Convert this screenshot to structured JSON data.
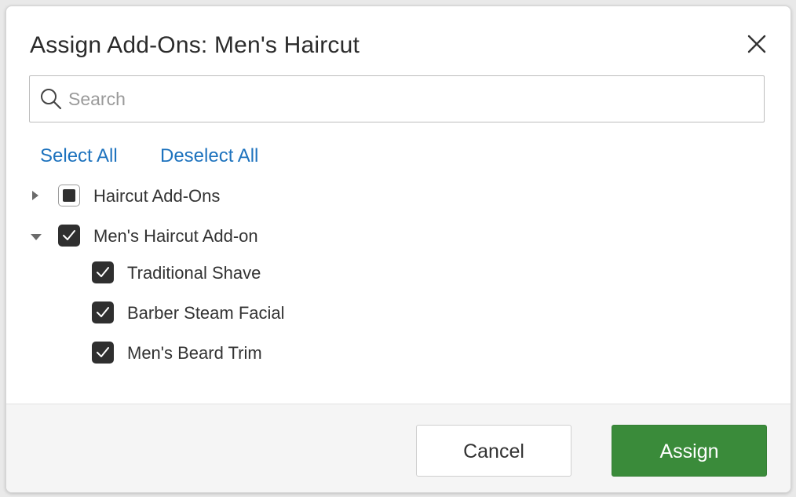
{
  "dialog": {
    "title": "Assign Add-Ons: Men's Haircut",
    "close_icon": "close-icon"
  },
  "search": {
    "placeholder": "Search",
    "value": "",
    "icon": "search-icon"
  },
  "actions": {
    "select_all": "Select All",
    "deselect_all": "Deselect All"
  },
  "tree": [
    {
      "label": "Haircut Add-Ons",
      "state": "indeterminate",
      "expanded": false,
      "children": []
    },
    {
      "label": "Men's Haircut Add-on",
      "state": "checked",
      "expanded": true,
      "children": [
        {
          "label": "Traditional Shave",
          "state": "checked"
        },
        {
          "label": "Barber Steam Facial",
          "state": "checked"
        },
        {
          "label": "Men's Beard Trim",
          "state": "checked"
        }
      ]
    }
  ],
  "footer": {
    "cancel_label": "Cancel",
    "assign_label": "Assign"
  },
  "colors": {
    "link": "#1e73be",
    "assign_button": "#3a8b3a",
    "checkbox_fill": "#2f2f2f"
  }
}
